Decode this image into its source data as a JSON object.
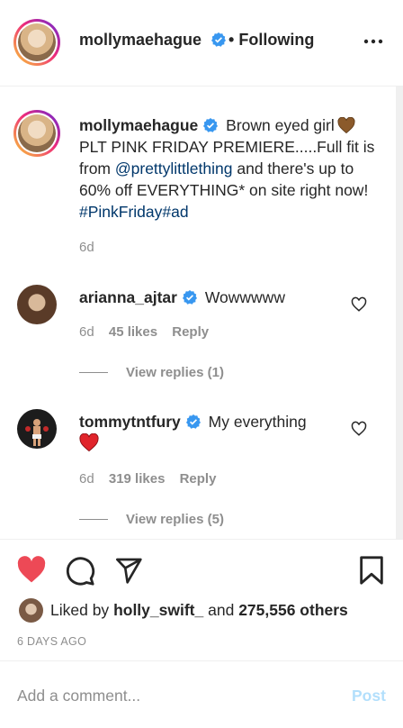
{
  "header": {
    "username": "mollymaehague",
    "bullet": "•",
    "following": "Following",
    "more_icon": "more-horizontal-icon"
  },
  "caption": {
    "username": "mollymaehague",
    "text_before": "Brown eyed girl",
    "text_main": "PLT PINK FRIDAY PREMIERE.....Full fit is from",
    "mention": "@prettylittlething",
    "text_after": "and there's up to 60% off EVERYTHING* on site right now!",
    "hashtag1": "#PinkFriday",
    "hashtag2": "#ad",
    "time": "6d"
  },
  "comments": [
    {
      "username": "arianna_ajtar",
      "text": "Wowwwww",
      "time": "6d",
      "likes": "45 likes",
      "reply": "Reply",
      "view_replies": "View replies (1)"
    },
    {
      "username": "tommytntfury",
      "text": "My everything",
      "time": "6d",
      "likes": "319 likes",
      "reply": "Reply",
      "view_replies": "View replies (5)"
    }
  ],
  "actions": {
    "like_icon": "heart-filled-icon",
    "comment_icon": "comment-icon",
    "share_icon": "send-icon",
    "save_icon": "bookmark-icon"
  },
  "likes": {
    "prefix": "Liked by",
    "user": "holly_swift_",
    "middle": "and",
    "count": "275,556 others"
  },
  "posted": "6 DAYS AGO",
  "add_comment": {
    "placeholder": "Add a comment...",
    "post": "Post"
  },
  "colors": {
    "verified": "#3897f0",
    "like_red": "#ed4956",
    "link": "#00376b",
    "muted": "#8e8e8e",
    "post_disabled": "#b2dffc"
  }
}
